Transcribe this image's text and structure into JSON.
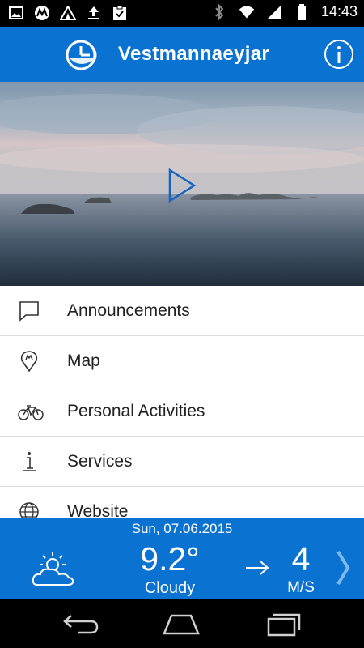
{
  "status_bar": {
    "time": "14:43",
    "icons_left": [
      "gallery-icon",
      "motorola-icon",
      "tent-icon",
      "upload-icon",
      "clipboard-check-icon"
    ],
    "icons_right": [
      "bluetooth-icon",
      "wifi-icon",
      "signal-icon",
      "battery-icon"
    ]
  },
  "app_bar": {
    "title": "Vestmannaeyjar",
    "logo_icon": "clock-logo-icon",
    "info_icon": "info-icon",
    "accent_color": "#0a73d1"
  },
  "hero": {
    "type": "video",
    "play_icon": "play-icon"
  },
  "menu": {
    "items": [
      {
        "label": "Announcements",
        "icon": "speech-bubble-icon"
      },
      {
        "label": "Map",
        "icon": "map-pin-icon"
      },
      {
        "label": "Personal Activities",
        "icon": "bicycle-icon"
      },
      {
        "label": "Services",
        "icon": "info-stand-icon"
      },
      {
        "label": "Website",
        "icon": "globe-icon"
      }
    ]
  },
  "weather": {
    "date": "Sun, 07.06.2015",
    "temperature": "9.2°",
    "condition": "Cloudy",
    "wind_speed": "4",
    "wind_unit": "M/S",
    "weather_icon": "partly-cloudy-icon",
    "wind_direction_icon": "arrow-right-icon",
    "next_icon": "chevron-right-icon"
  },
  "nav_bar": {
    "buttons": [
      "back-icon",
      "home-icon",
      "recent-apps-icon"
    ]
  }
}
